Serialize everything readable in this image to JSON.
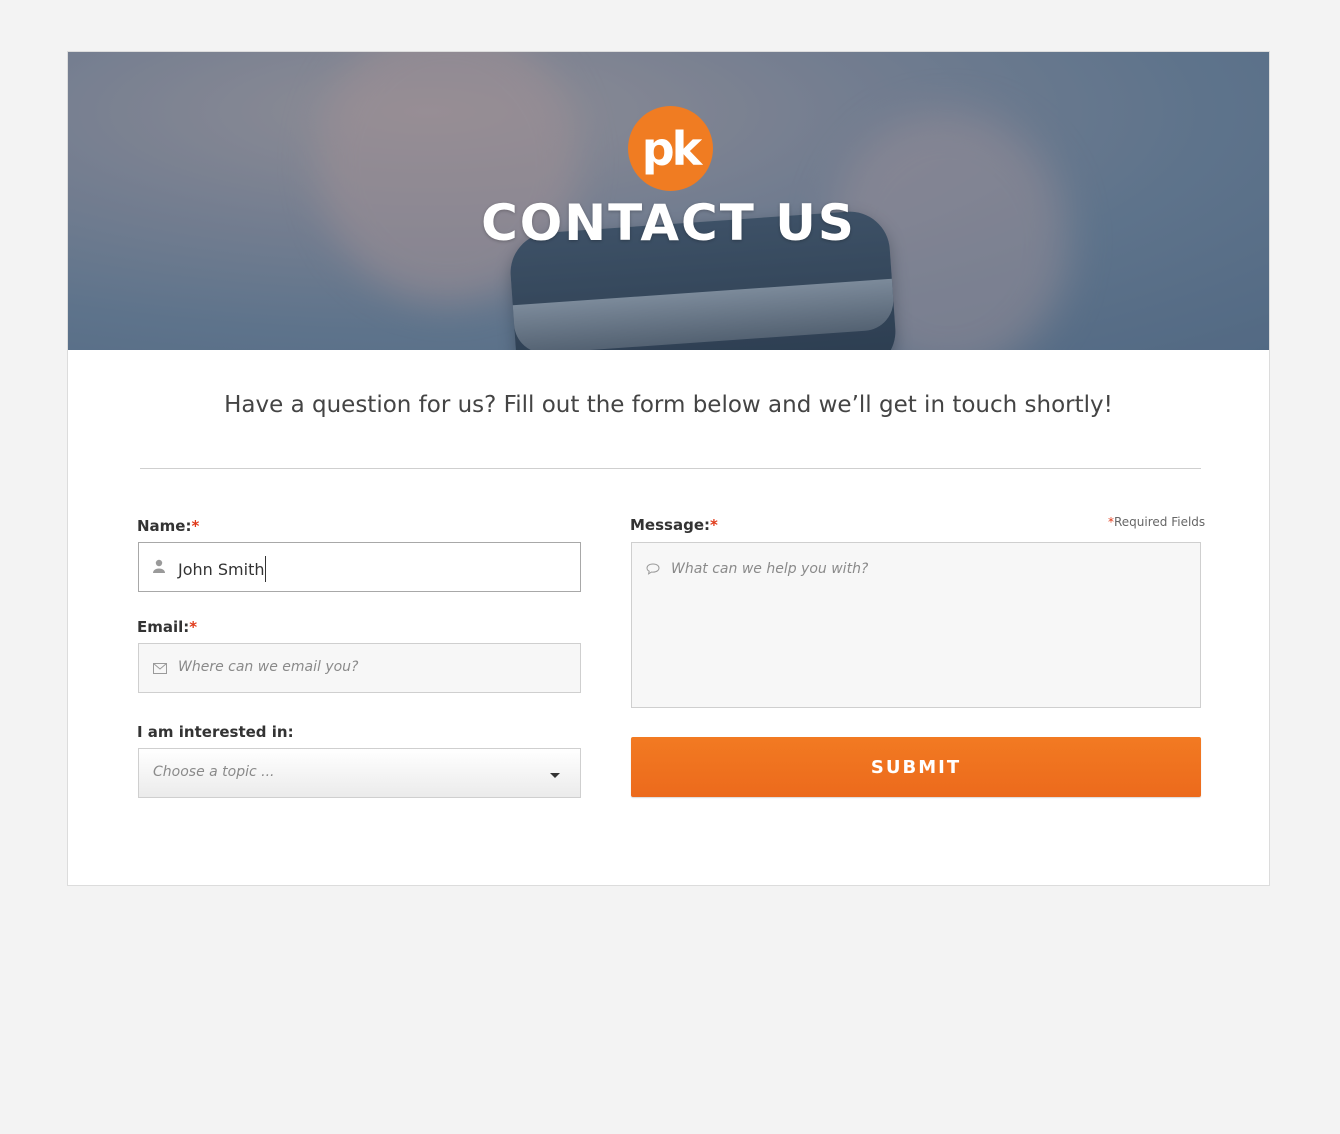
{
  "hero": {
    "logo_text": "pk",
    "title": "CONTACT US"
  },
  "intro": "Have a question for us? Fill out the form below and we’ll get in touch shortly!",
  "form": {
    "required_marker": "*",
    "required_note": "Required Fields",
    "name": {
      "label": "Name:",
      "value": "John Smith",
      "icon": "user-icon"
    },
    "email": {
      "label": "Email:",
      "placeholder": "Where can we email you?",
      "icon": "envelope-icon"
    },
    "topic": {
      "label": "I am interested in:",
      "placeholder": "Choose a topic ..."
    },
    "message": {
      "label": "Message:",
      "placeholder": "What can we help you with?",
      "icon": "speech-bubble-icon"
    },
    "submit_label": "SUBMIT"
  },
  "colors": {
    "accent": "#f07c22",
    "required": "#e03a1a",
    "page_bg": "#f3f3f3"
  }
}
